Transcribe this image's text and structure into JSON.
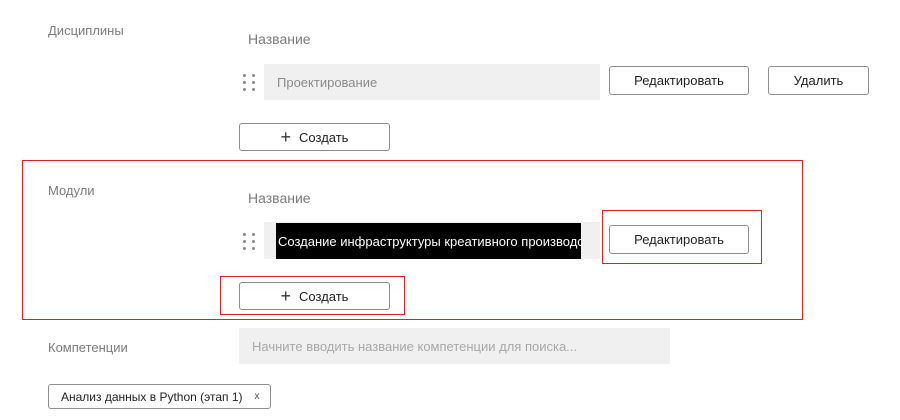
{
  "disciplines": {
    "section_label": "Дисциплины",
    "column_header": "Название",
    "items": [
      {
        "name": "Проектирование"
      }
    ],
    "edit_label": "Редактировать",
    "delete_label": "Удалить",
    "create_label": "Создать"
  },
  "modules": {
    "section_label": "Модули",
    "column_header": "Название",
    "items": [
      {
        "name": "Создание инфраструктуры креативного производства"
      }
    ],
    "edit_label": "Редактировать",
    "create_label": "Создать"
  },
  "competencies": {
    "section_label": "Компетенции",
    "search_placeholder": "Начните вводить название компетенции для поиска...",
    "search_value": "",
    "selected": [
      {
        "label": "Анализ данных в Python (этап 1)",
        "remove_glyph": "x"
      }
    ]
  },
  "icons": {
    "drag": "drag-handle-icon",
    "plus": "plus-icon",
    "remove": "close-icon"
  },
  "colors": {
    "highlight": "#d8232a",
    "field_bg": "#f0f0f0",
    "redaction": "#000000"
  }
}
